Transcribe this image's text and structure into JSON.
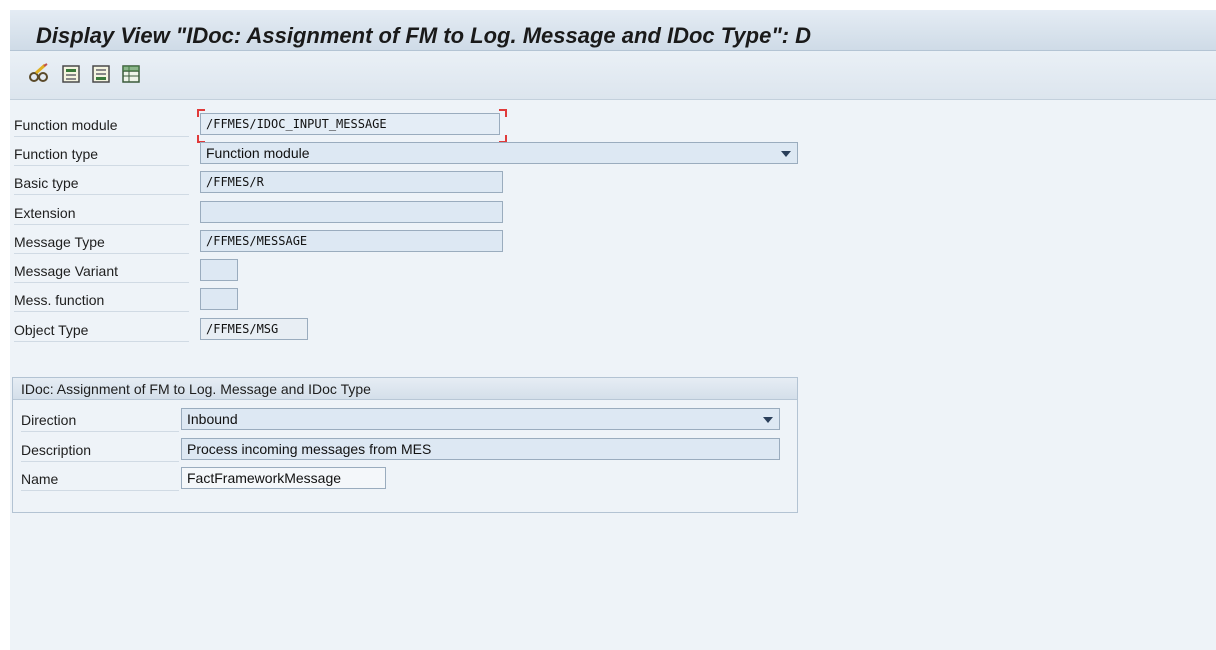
{
  "window": {
    "title": "Display View \"IDoc: Assignment of FM to Log. Message and IDoc Type\": D"
  },
  "toolbar": {
    "buttons": [
      {
        "icon": "glasses-edit-icon"
      },
      {
        "icon": "first-page-icon"
      },
      {
        "icon": "last-page-icon"
      },
      {
        "icon": "table-view-icon"
      }
    ]
  },
  "form": {
    "function_module": {
      "label": "Function module",
      "value": "/FFMES/IDOC_INPUT_MESSAGE"
    },
    "function_type": {
      "label": "Function type",
      "value": "Function module"
    },
    "basic_type": {
      "label": "Basic type",
      "value": "/FFMES/R"
    },
    "extension": {
      "label": "Extension",
      "value": ""
    },
    "message_type": {
      "label": "Message Type",
      "value": "/FFMES/MESSAGE"
    },
    "message_variant": {
      "label": "Message Variant",
      "value": ""
    },
    "mess_function": {
      "label": "Mess. function",
      "value": ""
    },
    "object_type": {
      "label": "Object Type",
      "value": "/FFMES/MSG"
    }
  },
  "group": {
    "title": "IDoc: Assignment of FM to Log. Message and IDoc Type",
    "direction": {
      "label": "Direction",
      "value": "Inbound"
    },
    "description": {
      "label": "Description",
      "value": "Process incoming messages from MES"
    },
    "name": {
      "label": "Name",
      "value": "FactFrameworkMessage"
    }
  },
  "colors": {
    "title_bar": "#cfdbe7",
    "content_bg": "#eef3f8",
    "field_bg": "#dde8f3",
    "focus": "#e03a3a"
  }
}
